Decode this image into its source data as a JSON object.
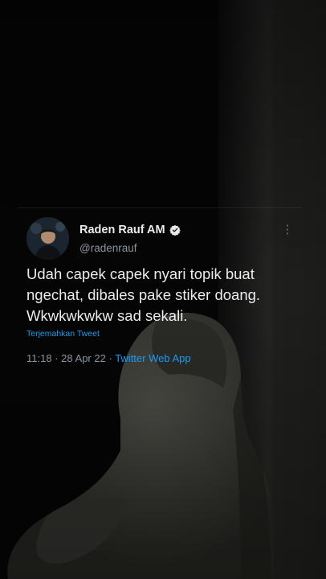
{
  "background": {
    "base_color": "#050505",
    "figure_color": "#3a3b36",
    "wall_color": "#2c2c2a",
    "description_icon": "hooded-figure-illustration"
  },
  "tweet": {
    "author_name": "Raden Rauf AM",
    "handle": "@radenrauf",
    "verified_icon": "verified-badge-icon",
    "more_icon": "more-options-icon",
    "text_lines": [
      "Udah capek capek nyari topik buat",
      "ngechat, dibales pake stiker doang.",
      "Wkwkwkwkw sad sekali."
    ],
    "translate_label": "Terjemahkan Tweet",
    "time": "11:18",
    "separator": "·",
    "date": "28 Apr 22",
    "source": "Twitter Web App",
    "link_color": "#1d9bf0",
    "muted_color": "#8b949c"
  }
}
